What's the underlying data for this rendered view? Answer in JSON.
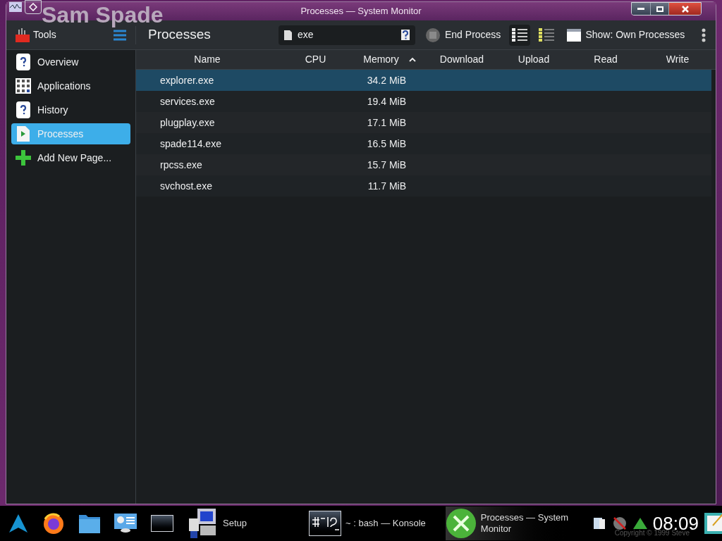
{
  "window": {
    "title": "Processes — System Monitor",
    "background_text": "Sam Spade"
  },
  "sidebar": {
    "header": "Tools",
    "items": [
      {
        "label": "Overview",
        "selected": false
      },
      {
        "label": "Applications",
        "selected": false
      },
      {
        "label": "History",
        "selected": false
      },
      {
        "label": "Processes",
        "selected": true
      },
      {
        "label": "Add New Page...",
        "selected": false
      }
    ]
  },
  "toolbar": {
    "title": "Processes",
    "search": {
      "value": "exe"
    },
    "end_process": "End Process",
    "view_buttons": [
      {
        "selected": true
      },
      {
        "selected": false
      }
    ],
    "show_filter": "Show: Own Processes"
  },
  "table": {
    "columns": [
      {
        "label": "Name",
        "sorted": false
      },
      {
        "label": "CPU",
        "sorted": false
      },
      {
        "label": "Memory",
        "sorted": true
      },
      {
        "label": "Download",
        "sorted": false
      },
      {
        "label": "Upload",
        "sorted": false
      },
      {
        "label": "Read",
        "sorted": false
      },
      {
        "label": "Write",
        "sorted": false
      }
    ],
    "rows": [
      {
        "name": "explorer.exe",
        "memory": "34.2 MiB",
        "selected": true
      },
      {
        "name": "services.exe",
        "memory": "19.4 MiB",
        "selected": false
      },
      {
        "name": "plugplay.exe",
        "memory": "17.1 MiB",
        "selected": false
      },
      {
        "name": "spade114.exe",
        "memory": "16.5 MiB",
        "selected": false
      },
      {
        "name": "rpcss.exe",
        "memory": "15.7 MiB",
        "selected": false
      },
      {
        "name": "svchost.exe",
        "memory": "11.7 MiB",
        "selected": false
      }
    ]
  },
  "taskbar": {
    "tasks": [
      {
        "label": "Setup",
        "selected": false
      },
      {
        "label": "~ : bash — Konsole",
        "selected": false
      },
      {
        "label": "Processes — System Monitor",
        "selected": true
      }
    ],
    "clock": "08:09",
    "copyright": "Copyright © 1999 Steve"
  }
}
